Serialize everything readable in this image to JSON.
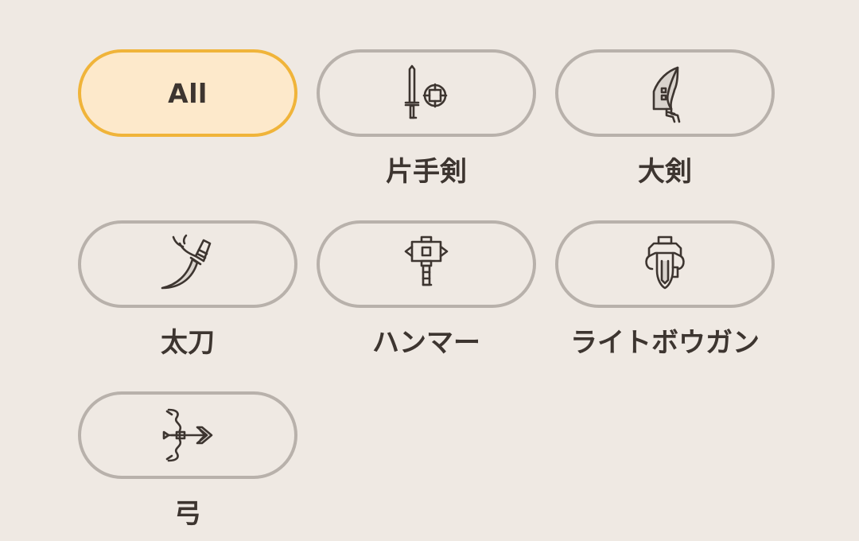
{
  "filters": [
    {
      "label": "All",
      "icon": "",
      "selected": true
    },
    {
      "label": "片手剣",
      "icon": "sword-and-shield-icon",
      "selected": false
    },
    {
      "label": "大剣",
      "icon": "great-sword-icon",
      "selected": false
    },
    {
      "label": "太刀",
      "icon": "long-sword-icon",
      "selected": false
    },
    {
      "label": "ハンマー",
      "icon": "hammer-icon",
      "selected": false
    },
    {
      "label": "ライトボウガン",
      "icon": "light-bowgun-icon",
      "selected": false
    },
    {
      "label": "弓",
      "icon": "bow-icon",
      "selected": false
    }
  ],
  "colors": {
    "background": "#efe9e3",
    "pill_border": "#b8b1ab",
    "selected_border": "#f0b43a",
    "selected_fill": "#fde9cb",
    "text": "#3d3530"
  }
}
